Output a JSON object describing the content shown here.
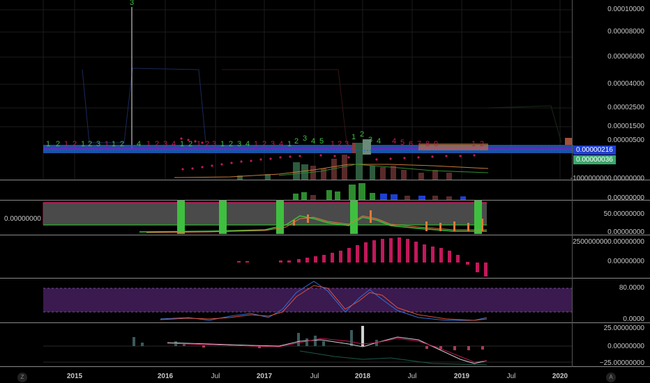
{
  "price_axis": {
    "labels": [
      "0.00010000",
      "0.00008000",
      "0.00006000",
      "0.00004000",
      "0.00002500",
      "0.00001500",
      "0.00000500"
    ],
    "last_price_tag": "0.00000216",
    "secondary_tag": "0.00000036"
  },
  "volume_axis": {
    "labels": [
      "-1000000000.00000000",
      "0.00000000"
    ]
  },
  "pane2": {
    "left_label": "0.00000000",
    "axis_labels": [
      "50.00000000",
      "0.00000000"
    ]
  },
  "pane3": {
    "axis_labels": [
      "2500000000.00000000",
      "0.00000000"
    ]
  },
  "pane4": {
    "axis_labels": [
      "80.0000",
      "0.0000"
    ]
  },
  "pane5": {
    "axis_labels": [
      "25.00000000",
      "0.00000000",
      "−25.00000000"
    ]
  },
  "time_axis": {
    "labels": [
      "2015",
      "2016",
      "Jul",
      "2017",
      "Jul",
      "2018",
      "Jul",
      "2019",
      "Jul",
      "2020"
    ],
    "bold": [
      true,
      true,
      false,
      true,
      false,
      true,
      false,
      true,
      false,
      true
    ]
  },
  "corners": {
    "left": "Z",
    "right": "A"
  },
  "td_counts": {
    "top": "3",
    "green_row": [
      "1",
      "2",
      "1",
      "2",
      "3",
      "1",
      "2",
      "4",
      "1",
      "2",
      "1",
      "2",
      "3",
      "4",
      "1",
      "2",
      "3",
      "4",
      "5",
      "1",
      "2",
      "3",
      "4"
    ],
    "red_row": [
      "1",
      "2",
      "1",
      "1",
      "2",
      "3",
      "4",
      "1",
      "2",
      "3",
      "1",
      "2",
      "3",
      "4",
      "1",
      "2",
      "3",
      "4",
      "5",
      "6",
      "7",
      "8",
      "9",
      "1",
      "2"
    ]
  },
  "colors": {
    "green": "#2e8b2e",
    "red": "#c2185b",
    "blue_band": "#1f5fbf",
    "purple_band": "#3a1a4f",
    "gray_band": "#6a6a6a"
  }
}
